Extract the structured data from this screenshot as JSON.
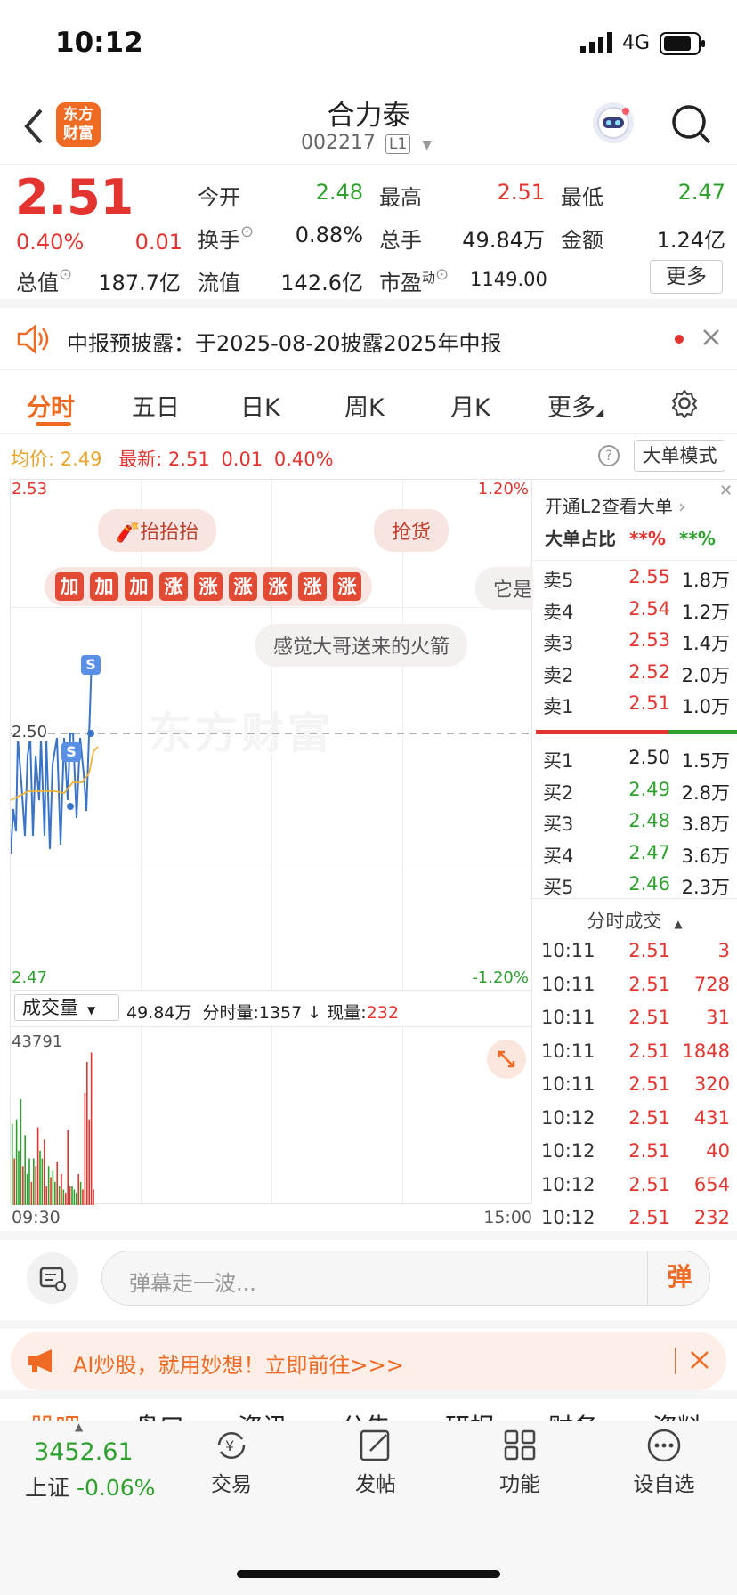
{
  "status": {
    "time": "10:12",
    "network": "4G"
  },
  "header": {
    "logo": "东方财富",
    "name": "合力泰",
    "code": "002217",
    "level": "L1"
  },
  "quote": {
    "price": "2.51",
    "pct": "0.40%",
    "chg": "0.01",
    "open_label": "今开",
    "open": "2.48",
    "high_label": "最高",
    "high": "2.51",
    "low_label": "最低",
    "low": "2.47",
    "turnover_label": "换手",
    "turnover": "0.88%",
    "vol_label": "总手",
    "vol": "49.84万",
    "amt_label": "金额",
    "amt": "1.24亿",
    "mcap_label": "总值",
    "mcap": "187.7亿",
    "float_label": "流值",
    "float": "142.6亿",
    "pe_label": "市盈",
    "pe_sup": "动",
    "pe": "1149.00",
    "more": "更多"
  },
  "notice": {
    "text": "中报预披露：于2025-08-20披露2025年中报"
  },
  "tabs": [
    "分时",
    "五日",
    "日K",
    "周K",
    "月K",
    "更多"
  ],
  "info": {
    "avg_label": "均价:",
    "avg": "2.49",
    "latest_label": "最新:",
    "latest": "2.51",
    "chg": "0.01",
    "pct": "0.40%",
    "big_mode": "大单模式"
  },
  "chart": {
    "top": "2.53",
    "mid": "2.50",
    "bot": "2.47",
    "top_pct": "1.20%",
    "bot_pct": "-1.20%",
    "watermark": "东方财富",
    "sig": "S"
  },
  "danmu": {
    "d1": "抬抬抬",
    "d2": "抢货",
    "d3": [
      "加",
      "加",
      "加",
      "涨",
      "涨",
      "涨",
      "涨",
      "涨",
      "涨"
    ],
    "d4": "感觉大哥送来的火箭",
    "d5": "它是"
  },
  "volume": {
    "selector": "成交量",
    "total": "49.84万",
    "fen_label": "分时量:",
    "fen": "1357",
    "cur_label": "现量:",
    "cur": "232",
    "max": "43791",
    "start": "09:30",
    "end": "15:00"
  },
  "volume_bars": [
    {
      "v": 0.52,
      "c": "g"
    },
    {
      "v": 0.3,
      "c": "r"
    },
    {
      "v": 0.55,
      "c": "g"
    },
    {
      "v": 0.35,
      "c": "g"
    },
    {
      "v": 0.68,
      "c": "g"
    },
    {
      "v": 0.25,
      "c": "r"
    },
    {
      "v": 0.45,
      "c": "g"
    },
    {
      "v": 0.2,
      "c": "g"
    },
    {
      "v": 0.3,
      "c": "g"
    },
    {
      "v": 0.15,
      "c": "r"
    },
    {
      "v": 0.3,
      "c": "g"
    },
    {
      "v": 0.25,
      "c": "r"
    },
    {
      "v": 0.5,
      "c": "r"
    },
    {
      "v": 0.35,
      "c": "g"
    },
    {
      "v": 0.3,
      "c": "g"
    },
    {
      "v": 0.42,
      "c": "r"
    },
    {
      "v": 0.12,
      "c": "r"
    },
    {
      "v": 0.25,
      "c": "g"
    },
    {
      "v": 0.18,
      "c": "r"
    },
    {
      "v": 0.22,
      "c": "g"
    },
    {
      "v": 0.15,
      "c": "g"
    },
    {
      "v": 0.28,
      "c": "r"
    },
    {
      "v": 0.12,
      "c": "g"
    },
    {
      "v": 0.2,
      "c": "r"
    },
    {
      "v": 0.1,
      "c": "g"
    },
    {
      "v": 0.08,
      "c": "r"
    },
    {
      "v": 0.48,
      "c": "r"
    },
    {
      "v": 0.12,
      "c": "r"
    },
    {
      "v": 0.12,
      "c": "g"
    },
    {
      "v": 0.1,
      "c": "g"
    },
    {
      "v": 0.08,
      "c": "g"
    },
    {
      "v": 0.2,
      "c": "r"
    },
    {
      "v": 0.15,
      "c": "g"
    },
    {
      "v": 0.1,
      "c": "r"
    },
    {
      "v": 0.72,
      "c": "r"
    },
    {
      "v": 0.92,
      "c": "r"
    },
    {
      "v": 0.55,
      "c": "r"
    },
    {
      "v": 0.98,
      "c": "r"
    },
    {
      "v": 0.1,
      "c": "r"
    }
  ],
  "orderbook": {
    "l2": "开通L2查看大单",
    "big_ratio": "大单占比",
    "r1": "**%",
    "r2": "**%",
    "sell": [
      {
        "l": "卖5",
        "p": "2.55",
        "v": "1.8万"
      },
      {
        "l": "卖4",
        "p": "2.54",
        "v": "1.2万"
      },
      {
        "l": "卖3",
        "p": "2.53",
        "v": "1.4万"
      },
      {
        "l": "卖2",
        "p": "2.52",
        "v": "2.0万"
      },
      {
        "l": "卖1",
        "p": "2.51",
        "v": "1.0万"
      }
    ],
    "buy": [
      {
        "l": "买1",
        "p": "2.50",
        "v": "1.5万"
      },
      {
        "l": "买2",
        "p": "2.49",
        "v": "2.8万"
      },
      {
        "l": "买3",
        "p": "2.48",
        "v": "3.8万"
      },
      {
        "l": "买4",
        "p": "2.47",
        "v": "3.6万"
      },
      {
        "l": "买5",
        "p": "2.46",
        "v": "2.3万"
      }
    ]
  },
  "trades": {
    "title": "分时成交",
    "rows": [
      {
        "t": "10:11",
        "p": "2.51",
        "v": "3"
      },
      {
        "t": "10:11",
        "p": "2.51",
        "v": "728"
      },
      {
        "t": "10:11",
        "p": "2.51",
        "v": "31"
      },
      {
        "t": "10:11",
        "p": "2.51",
        "v": "1848"
      },
      {
        "t": "10:11",
        "p": "2.51",
        "v": "320"
      },
      {
        "t": "10:12",
        "p": "2.51",
        "v": "431"
      },
      {
        "t": "10:12",
        "p": "2.51",
        "v": "40"
      },
      {
        "t": "10:12",
        "p": "2.51",
        "v": "654"
      },
      {
        "t": "10:12",
        "p": "2.51",
        "v": "232"
      }
    ]
  },
  "comment": {
    "placeholder": "弹幕走一波...",
    "dan": "弹"
  },
  "ad": {
    "text": "AI炒股，就用妙想！立即前往>>>"
  },
  "subtabs": [
    "股吧",
    "盘口",
    "资讯",
    "公告",
    "研报",
    "财务",
    "资料"
  ],
  "bottom": {
    "index_val": "3452.61",
    "index_name": "上证",
    "index_pct": "-0.06%",
    "trade": "交易",
    "post": "发帖",
    "func": "功能",
    "watch": "设自选"
  }
}
